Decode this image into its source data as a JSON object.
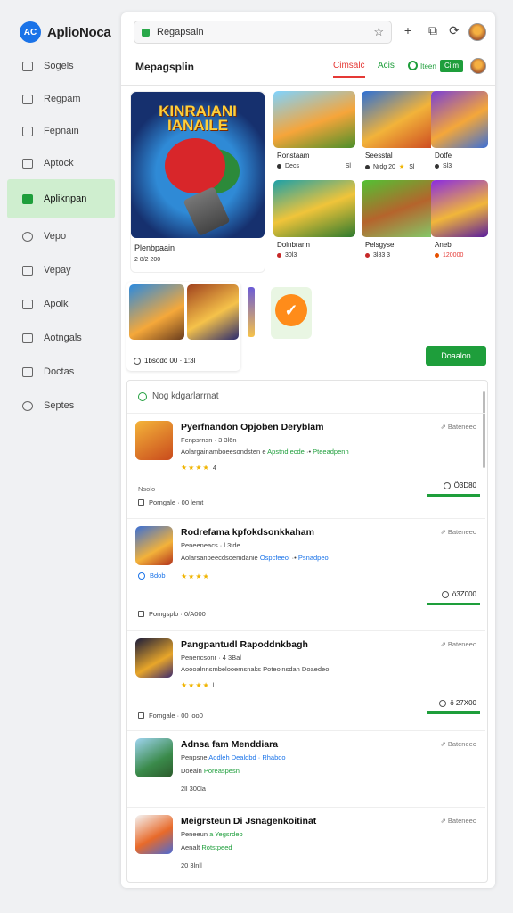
{
  "app": {
    "name": "AplioNoca",
    "logo_letters": "AC"
  },
  "sidebar": {
    "items": [
      {
        "label": "Sogels"
      },
      {
        "label": "Regpam"
      },
      {
        "label": "Fepnain"
      },
      {
        "label": "Aptock"
      },
      {
        "label": "Apliknpan",
        "active": true
      },
      {
        "label": "Vepo"
      },
      {
        "label": "Vepay"
      },
      {
        "label": "Apolk"
      },
      {
        "label": "Aotngals"
      },
      {
        "label": "Doctas"
      },
      {
        "label": "Septes"
      }
    ]
  },
  "browser": {
    "url": "Regapsain",
    "star_icon": "star-icon"
  },
  "header": {
    "title": "Mepagsplin",
    "tab_active": "Cimsalc",
    "tab_2": "Acis",
    "tab_3": "Iteen",
    "badge": "Ciim"
  },
  "featured": {
    "title": "KINRAIANI IANAILE",
    "name": "Plenbpaain",
    "meta": "2 8/2 200"
  },
  "cards": [
    {
      "name": "Ronstaam",
      "meta": "Decs",
      "extra": "Sl"
    },
    {
      "name": "Seesstal",
      "meta": "Nrdg 20",
      "extra": "Sl"
    },
    {
      "name": "Dotfe",
      "meta": "Sl3"
    },
    {
      "name": "Dolnbrann",
      "meta": "30l3"
    },
    {
      "name": "Pelsgyse",
      "meta": "3l83 3"
    },
    {
      "name": "Anebl",
      "meta": "120000"
    }
  ],
  "strip": {
    "label": "1bsodo 00 · 1:3l",
    "button": "Doaalon"
  },
  "list": {
    "header": "Nog kdgarlarrnat",
    "rows": [
      {
        "title": "Pyerfnandon Opjoben Deryblam",
        "line1": "Fenpsrnsn · 3 3l6n",
        "line2a": "Aolargainamboeesondsten e ",
        "line2b": "Apstnd ecde",
        "line2c": " ·• ",
        "line2d": "Pteeadpenn",
        "stars": "★★★★",
        "rating": "4",
        "note": "Nsolo",
        "small": "Porngale · 00 lemt",
        "right": "⇗ Bateneeo",
        "price": "Ö3D80"
      },
      {
        "title": "Rodrefama kpfokdsonkkaham",
        "line1": "Peneeneacs · l 3tde",
        "line2a": "Aolarsanbeecdsoemdanie ",
        "line2b": "Ospcfeeol",
        "line2c": " ·• ",
        "line2d": "Psnadpeo",
        "stars": "★★★★",
        "rating": "",
        "note": "Bdob",
        "small": "Pomgsplo · 0/A000",
        "right": "⇗ Bateneeo",
        "price": "ö3Z000"
      },
      {
        "title": "Pangpantudl Rapoddnkbagh",
        "line1": "Penencsonr · 4 3Bal",
        "line2a": "Aoooalnnsmbelooemsnaks ",
        "line2b": "",
        "line2c": "",
        "line2d": "Poteolnsdan Doaedeo",
        "stars": "★★★★",
        "rating": "l",
        "note": "",
        "small": "Forngale · 00 loo0",
        "right": "⇗ Bateneeo",
        "price": "ö 27X00"
      },
      {
        "title": "Adnsa fam Menddiara",
        "line1": "Penpsne ",
        "line2a": "",
        "line2b": "Aodleh Dealdbd · Rhabdo",
        "line2c": "",
        "line2d": "",
        "line3": "Doeain ",
        "line3g": "Poreaspesn",
        "stars": "",
        "rating": "",
        "note": "",
        "small": "2ll 300la",
        "right": "⇗ Bateneeo",
        "price": ""
      },
      {
        "title": "Meigrsteun Di Jsnagenkoitinat",
        "line1": "Peneeun ",
        "line2a": "",
        "line2b": "a Yegsrdeb",
        "line2c": "",
        "line2d": "",
        "line3": "Aenalt ",
        "line3g": "Rotstpeed",
        "stars": "",
        "rating": "",
        "note": "",
        "small": "20 3lnll",
        "right": "⇗ Bateneeo",
        "price": ""
      }
    ]
  },
  "colors": {
    "accent_green": "#1e9e3b",
    "accent_red": "#e53935",
    "brand_blue": "#1a73e8",
    "star_yellow": "#f0b400"
  }
}
